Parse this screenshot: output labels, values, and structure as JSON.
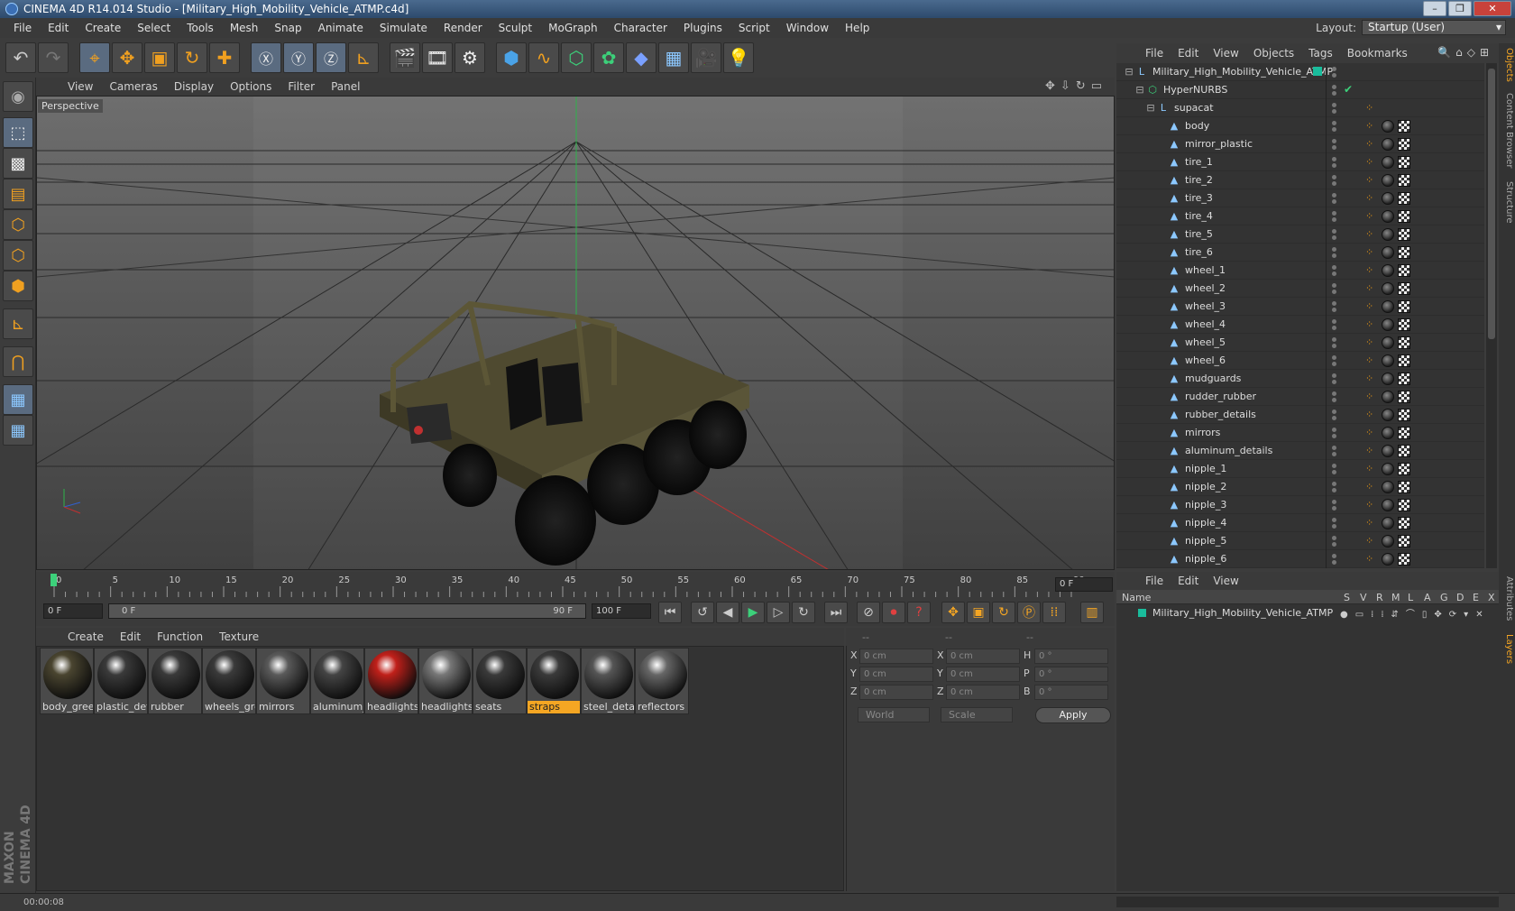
{
  "window": {
    "title": "CINEMA 4D R14.014 Studio - [Military_High_Mobility_Vehicle_ATMP.c4d]"
  },
  "menu": [
    "File",
    "Edit",
    "Create",
    "Select",
    "Tools",
    "Mesh",
    "Snap",
    "Animate",
    "Simulate",
    "Render",
    "Sculpt",
    "MoGraph",
    "Character",
    "Plugins",
    "Script",
    "Window",
    "Help"
  ],
  "layout": {
    "label": "Layout:",
    "value": "Startup (User)"
  },
  "viewport": {
    "menu": [
      "View",
      "Cameras",
      "Display",
      "Options",
      "Filter",
      "Panel"
    ],
    "label": "Perspective"
  },
  "timeline": {
    "ticks": [
      "0",
      "5",
      "10",
      "15",
      "20",
      "25",
      "30",
      "35",
      "40",
      "45",
      "50",
      "55",
      "60",
      "65",
      "70",
      "75",
      "80",
      "85",
      "90"
    ],
    "frame": "0 F",
    "start": "0 F",
    "range_start": "0 F",
    "range_end": "90 F",
    "end": "100 F"
  },
  "material_manager": {
    "menu": [
      "Create",
      "Edit",
      "Function",
      "Texture"
    ],
    "materials": [
      {
        "name": "body_greei",
        "color": "#4a4530",
        "selected": false
      },
      {
        "name": "plastic_det",
        "color": "#3a3a3a",
        "selected": false
      },
      {
        "name": "rubber",
        "color": "#3a3a3a",
        "selected": false
      },
      {
        "name": "wheels_gre",
        "color": "#3a3a3a",
        "selected": false
      },
      {
        "name": "mirrors",
        "color": "#5a5a5a",
        "selected": false
      },
      {
        "name": "aluminum_",
        "color": "#444444",
        "selected": false
      },
      {
        "name": "headlights",
        "color": "#c0201a",
        "selected": false
      },
      {
        "name": "headlights",
        "color": "#777777",
        "selected": false
      },
      {
        "name": "seats",
        "color": "#3a3a3a",
        "selected": false
      },
      {
        "name": "straps",
        "color": "#3a3a3a",
        "selected": true
      },
      {
        "name": "steel_detai",
        "color": "#555555",
        "selected": false
      },
      {
        "name": "reflectors",
        "color": "#666666",
        "selected": false
      }
    ]
  },
  "coordinates": {
    "header": [
      "--",
      "--",
      "--"
    ],
    "rows": [
      {
        "a": "X",
        "av": "0 cm",
        "b": "X",
        "bv": "0 cm",
        "c": "H",
        "cv": "0 °"
      },
      {
        "a": "Y",
        "av": "0 cm",
        "b": "Y",
        "bv": "0 cm",
        "c": "P",
        "cv": "0 °"
      },
      {
        "a": "Z",
        "av": "0 cm",
        "b": "Z",
        "bv": "0 cm",
        "c": "B",
        "cv": "0 °"
      }
    ],
    "mode": "World",
    "scale": "Scale",
    "apply": "Apply"
  },
  "object_manager": {
    "menu": [
      "File",
      "Edit",
      "View",
      "Objects",
      "Tags",
      "Bookmarks"
    ],
    "objects": [
      {
        "name": "Military_High_Mobility_Vehicle_ATMP",
        "level": 0,
        "kind": "null"
      },
      {
        "name": "HyperNURBS",
        "level": 1,
        "kind": "nurbs"
      },
      {
        "name": "supacat",
        "level": 2,
        "kind": "null"
      },
      {
        "name": "body",
        "level": 3,
        "kind": "mesh"
      },
      {
        "name": "mirror_plastic",
        "level": 3,
        "kind": "mesh"
      },
      {
        "name": "tire_1",
        "level": 3,
        "kind": "mesh"
      },
      {
        "name": "tire_2",
        "level": 3,
        "kind": "mesh"
      },
      {
        "name": "tire_3",
        "level": 3,
        "kind": "mesh"
      },
      {
        "name": "tire_4",
        "level": 3,
        "kind": "mesh"
      },
      {
        "name": "tire_5",
        "level": 3,
        "kind": "mesh"
      },
      {
        "name": "tire_6",
        "level": 3,
        "kind": "mesh"
      },
      {
        "name": "wheel_1",
        "level": 3,
        "kind": "mesh"
      },
      {
        "name": "wheel_2",
        "level": 3,
        "kind": "mesh"
      },
      {
        "name": "wheel_3",
        "level": 3,
        "kind": "mesh"
      },
      {
        "name": "wheel_4",
        "level": 3,
        "kind": "mesh"
      },
      {
        "name": "wheel_5",
        "level": 3,
        "kind": "mesh"
      },
      {
        "name": "wheel_6",
        "level": 3,
        "kind": "mesh"
      },
      {
        "name": "mudguards",
        "level": 3,
        "kind": "mesh"
      },
      {
        "name": "rudder_rubber",
        "level": 3,
        "kind": "mesh"
      },
      {
        "name": "rubber_details",
        "level": 3,
        "kind": "mesh"
      },
      {
        "name": "mirrors",
        "level": 3,
        "kind": "mesh"
      },
      {
        "name": "aluminum_details",
        "level": 3,
        "kind": "mesh"
      },
      {
        "name": "nipple_1",
        "level": 3,
        "kind": "mesh"
      },
      {
        "name": "nipple_2",
        "level": 3,
        "kind": "mesh"
      },
      {
        "name": "nipple_3",
        "level": 3,
        "kind": "mesh"
      },
      {
        "name": "nipple_4",
        "level": 3,
        "kind": "mesh"
      },
      {
        "name": "nipple_5",
        "level": 3,
        "kind": "mesh"
      },
      {
        "name": "nipple_6",
        "level": 3,
        "kind": "mesh"
      }
    ]
  },
  "layer_manager": {
    "menu": [
      "File",
      "Edit",
      "View"
    ],
    "columns": [
      "Name",
      "S",
      "V",
      "R",
      "M",
      "L",
      "A",
      "G",
      "D",
      "E",
      "X"
    ],
    "layers": [
      {
        "name": "Military_High_Mobility_Vehicle_ATMP",
        "color": "#1abc9c"
      }
    ]
  },
  "side_tabs": [
    "Objects",
    "Content Browser",
    "Structure",
    "Attributes",
    "Layers"
  ],
  "brand": "MAXON CINEMA 4D",
  "status": "00:00:08"
}
